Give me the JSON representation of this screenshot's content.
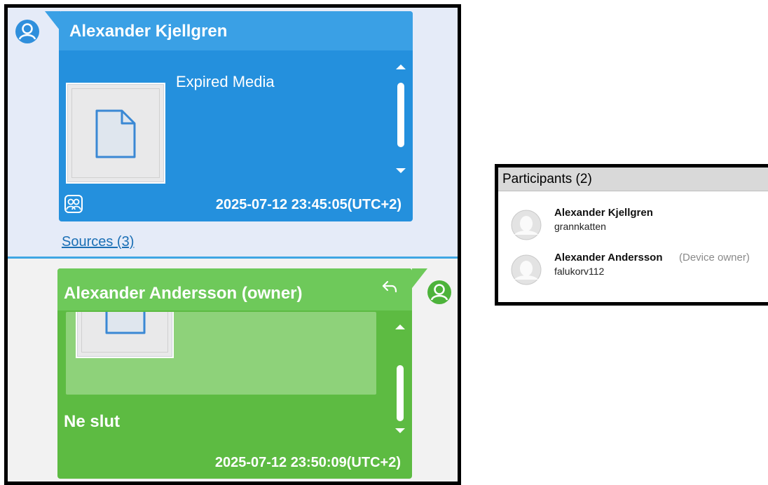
{
  "chat": {
    "messages": [
      {
        "sender": "Alexander Kjellgren",
        "attachment_label": "Expired Media",
        "timestamp": "2025-07-12 23:45:05(UTC+2)",
        "color": "#2490dd"
      },
      {
        "sender": "Alexander Andersson (owner)",
        "text": "Ne slut",
        "timestamp": "2025-07-12 23:50:09(UTC+2)",
        "color": "#5dbb42"
      }
    ],
    "sources_label": "Sources (3)"
  },
  "participants": {
    "title": "Participants (2)",
    "list": [
      {
        "name": "Alexander Kjellgren",
        "handle": "grannkatten",
        "role": ""
      },
      {
        "name": "Alexander Andersson",
        "handle": "falukorv112",
        "role": "(Device owner)"
      }
    ]
  },
  "icons": [
    "user-avatar-icon",
    "file-icon",
    "participants-icon",
    "reply-icon",
    "scroll-up-icon",
    "scroll-down-icon"
  ]
}
